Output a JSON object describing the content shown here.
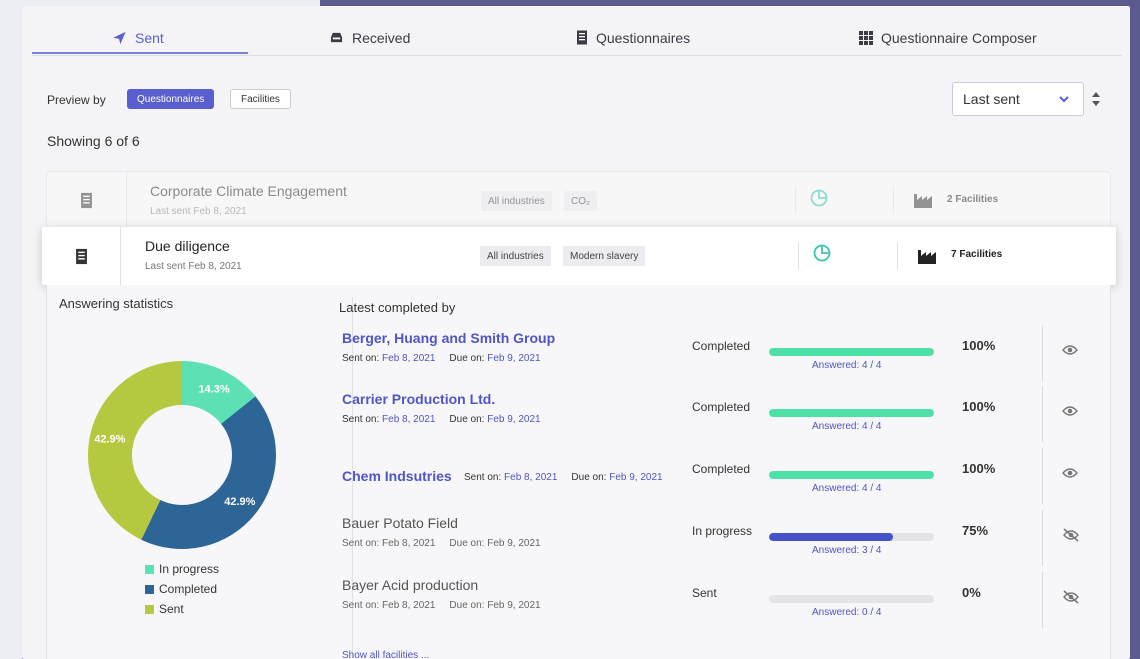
{
  "tabs": [
    {
      "label": "Sent",
      "icon": "send-icon"
    },
    {
      "label": "Received",
      "icon": "inbox-icon"
    },
    {
      "label": "Questionnaires",
      "icon": "document-icon"
    },
    {
      "label": "Questionnaire Composer",
      "icon": "grid-icon"
    }
  ],
  "preview": {
    "label": "Preview by",
    "options": [
      "Questionnaires",
      "Facilities"
    ],
    "selected": "Questionnaires"
  },
  "sort": {
    "value": "Last sent"
  },
  "showing": "Showing 6 of 6",
  "questionnaires": [
    {
      "title": "Corporate Climate Engagement",
      "last_sent": "Last sent Feb 8, 2021",
      "tags": [
        "All industries",
        "CO₂"
      ],
      "facilities": "2 Facilities"
    },
    {
      "title": "Due diligence",
      "last_sent": "Last sent Feb 8, 2021",
      "tags": [
        "All industries",
        "Modern slavery"
      ],
      "facilities": "7 Facilities"
    }
  ],
  "stats": {
    "title": "Answering statistics",
    "legend": [
      "In progress",
      "Completed",
      "Sent"
    ],
    "colors": {
      "in_progress": "#5ee0b5",
      "completed": "#2d6596",
      "sent": "#b6c840"
    }
  },
  "chart_data": {
    "type": "pie",
    "categories": [
      "In progress",
      "Completed",
      "Sent"
    ],
    "values": [
      14.3,
      42.9,
      42.9
    ],
    "labels": [
      "14.3%",
      "42.9%",
      "42.9%"
    ]
  },
  "latest": {
    "title": "Latest completed by",
    "rows": [
      {
        "name": "Berger, Huang and Smith Group",
        "sent_label": "Sent on:",
        "sent": "Feb 8, 2021",
        "due_label": "Due on:",
        "due": "Feb 9, 2021",
        "status": "Completed",
        "progress": 1.0,
        "answered_label": "Answered:",
        "answered": "4 / 4",
        "pct": "100%",
        "visibility_icon": "eye-icon"
      },
      {
        "name": "Carrier Production Ltd.",
        "sent_label": "Sent on:",
        "sent": "Feb 8, 2021",
        "due_label": "Due on:",
        "due": "Feb 9, 2021",
        "status": "Completed",
        "progress": 1.0,
        "answered_label": "Answered:",
        "answered": "4 / 4",
        "pct": "100%",
        "visibility_icon": "eye-icon"
      },
      {
        "name": "Chem Indsutries",
        "sent_label": "Sent on:",
        "sent": "Feb 8, 2021",
        "due_label": "Due on:",
        "due": "Feb 9, 2021",
        "status": "Completed",
        "progress": 1.0,
        "answered_label": "Answered:",
        "answered": "4 / 4",
        "pct": "100%",
        "visibility_icon": "eye-icon"
      },
      {
        "name": "Bauer Potato Field",
        "sent_label": "Sent on:",
        "sent": "Feb 8, 2021",
        "due_label": "Due on:",
        "due": "Feb 9, 2021",
        "status": "In progress",
        "progress": 0.75,
        "answered_label": "Answered:",
        "answered": "3 / 4",
        "pct": "75%",
        "visibility_icon": "eye-off-icon"
      },
      {
        "name": "Bayer Acid production",
        "sent_label": "Sent on:",
        "sent": "Feb 8, 2021",
        "due_label": "Due on:",
        "due": "Feb 9, 2021",
        "status": "Sent",
        "progress": 0.0,
        "answered_label": "Answered:",
        "answered": "0 / 4",
        "pct": "0%",
        "visibility_icon": "eye-off-icon"
      }
    ],
    "show_all": "Show all facilities ..."
  }
}
